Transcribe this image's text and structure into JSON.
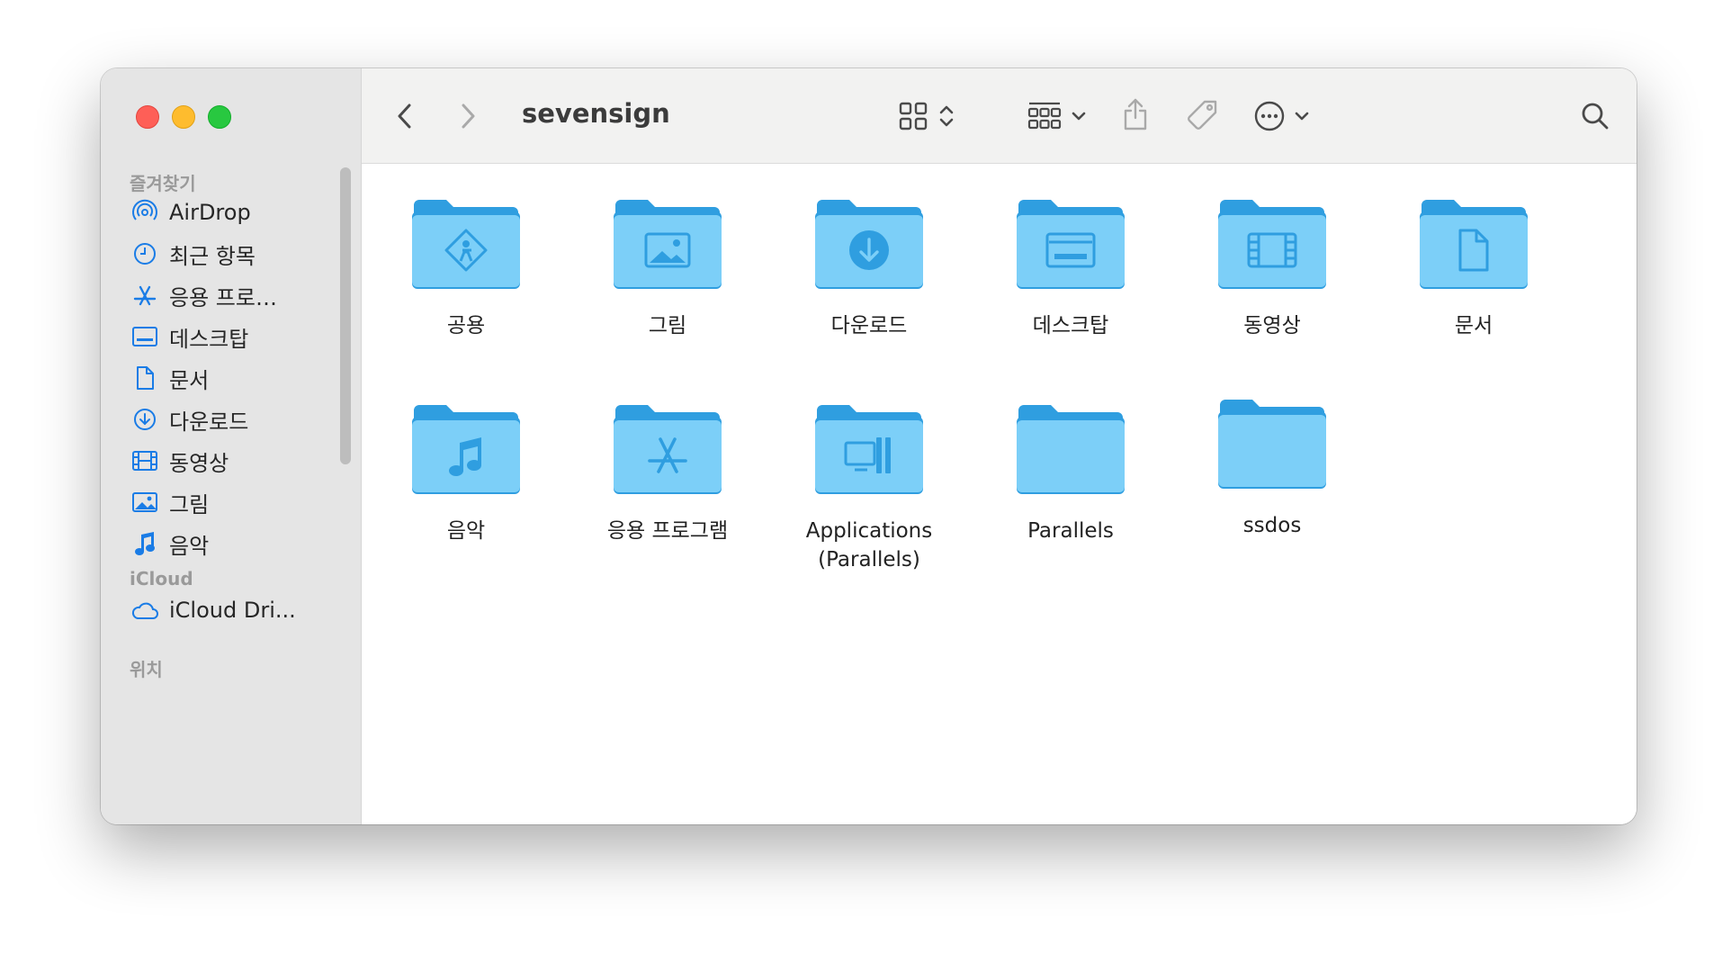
{
  "window": {
    "path_title": "sevensign"
  },
  "sidebar": {
    "sections": [
      {
        "title": "즐겨찾기",
        "items": [
          {
            "label": "AirDrop",
            "icon": "airdrop-icon"
          },
          {
            "label": "최근 항목",
            "icon": "clock-icon"
          },
          {
            "label": "응용 프로…",
            "icon": "applications-icon"
          },
          {
            "label": "데스크탑",
            "icon": "desktop-icon"
          },
          {
            "label": "문서",
            "icon": "document-icon"
          },
          {
            "label": "다운로드",
            "icon": "download-icon"
          },
          {
            "label": "동영상",
            "icon": "film-icon"
          },
          {
            "label": "그림",
            "icon": "photo-icon"
          },
          {
            "label": "음악",
            "icon": "music-icon"
          }
        ]
      },
      {
        "title": "iCloud",
        "items": [
          {
            "label": "iCloud Dri...",
            "icon": "cloud-icon"
          }
        ]
      },
      {
        "title": "위치",
        "items": []
      }
    ]
  },
  "files": [
    {
      "name": "공용",
      "badge": "public"
    },
    {
      "name": "그림",
      "badge": "photo"
    },
    {
      "name": "다운로드",
      "badge": "download"
    },
    {
      "name": "데스크탑",
      "badge": "desktop"
    },
    {
      "name": "동영상",
      "badge": "film"
    },
    {
      "name": "문서",
      "badge": "document"
    },
    {
      "name": "음악",
      "badge": "music"
    },
    {
      "name": "응용 프로그램",
      "badge": "applications"
    },
    {
      "name": "Applications\n(Parallels)",
      "badge": "parallels"
    },
    {
      "name": "Parallels",
      "badge": "none"
    },
    {
      "name": "ssdos",
      "badge": "none"
    }
  ],
  "colors": {
    "folder_light": "#7ccff8",
    "folder_dark": "#2f9ee0",
    "sidebar_icon": "#1a7ce6",
    "close": "#fe5f57",
    "minimize": "#febc2e",
    "maximize": "#28c840"
  }
}
